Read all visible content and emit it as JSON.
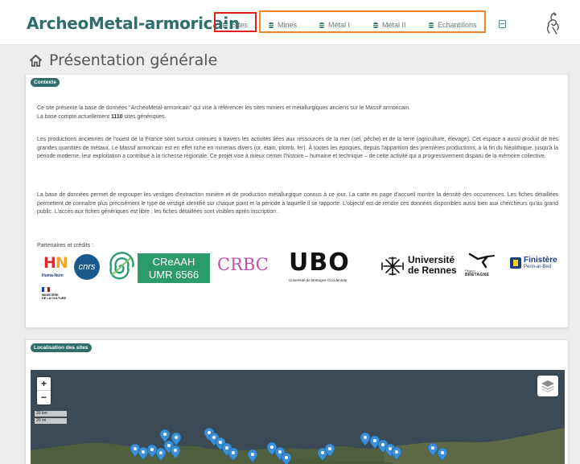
{
  "header": {
    "brand": "ArcheoMetal-armoricain",
    "nav": [
      {
        "label": "Sites"
      },
      {
        "label": "Mines"
      },
      {
        "label": "Métal I"
      },
      {
        "label": "Métal II"
      },
      {
        "label": "Echantillons"
      }
    ]
  },
  "page": {
    "title": "Présentation générale"
  },
  "context": {
    "badge": "Contexte",
    "intro_line1": "Ce site présente la base de données \"ArcheoMetal-armoricain\" qui vise à référencer les sites miniers et métallurgiques anciens sur le Massif armoricain.",
    "intro_line2_prefix": "La base compte actuellement",
    "site_count": "1110",
    "intro_line2_suffix": "sites génériques.",
    "paragraph1": "Les productions anciennes de l'ouest de la France sont surtout connues à travers les activités liées aux ressources de la mer (sel, pêche) et de la terre (agriculture, élevage). Cet espace a aussi produit de très grandes quantités de métaux. Le Massif armoricain est en effet riche en minerais divers (or, étain, plomb, fer). À toutes les époques, depuis l'apparition des premières productions, à la fin du Néolithique, jusqu'à la période moderne, leur exploitation a contribué à la richesse régionale. Ce projet vise à mieux cerner l'histoire – humaine et technique – de cette activité qui a progressivement disparu de la mémoire collective.",
    "paragraph2": "La base de données permet de regrouper les vestiges d'extraction minière et de production métallurgique connus à ce jour. La carte en page d'accueil montre la densité des occurrences. Les fiches détaillées permettent de connaître plus précisément le type de vestige identifié sur chaque point et la période à laquelle il se rapporte. L'objectif est de rendre ces données disponibles aussi bien aux chercheurs qu'au grand public. L'accès aux fiches génériques est libre ; les fiches détaillées sont visibles après inscription .",
    "partners_label": "Partenaires et crédits :",
    "partners": {
      "huma_num": {
        "letter_h": "H",
        "letter_n": "N",
        "caption": "Huma-Num"
      },
      "cnrs": "cnrs",
      "creaah_line1": "CReAAH",
      "creaah_line2": "UMR 6566",
      "crbc": "CRBC",
      "ubo": {
        "letters": "UBO",
        "caption": "Université de Bretagne Occidentale"
      },
      "rennes_line1": "Université",
      "rennes_line2": "de Rennes",
      "bretagne": {
        "small": "Région",
        "caption": "BRETAGNE"
      },
      "finistere": {
        "name": "Finistère",
        "sub": "Penn-ar-Bed"
      },
      "ministere": [
        "MINISTÈRE",
        "DE LA CULTURE"
      ]
    }
  },
  "map_section": {
    "badge": "Localisation des sites",
    "zoom_in": "+",
    "zoom_out": "−",
    "scale_km": "30 km",
    "scale_mi": "20 mi"
  },
  "colors": {
    "brand": "#2f6e6a",
    "highlight_red": "#e0201e",
    "highlight_orange": "#f08126",
    "marker": "#3d8fd6"
  },
  "icons": {
    "nav": "database-icon",
    "title": "home-icon",
    "login": "sign-in-icon",
    "map_layers": "layers-icon"
  }
}
